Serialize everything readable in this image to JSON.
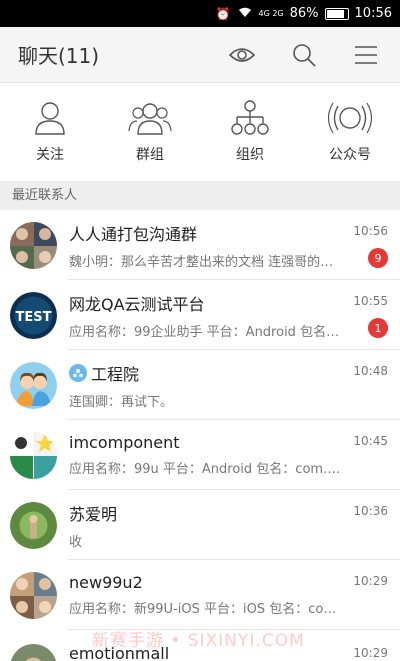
{
  "status_bar": {
    "battery": "86%",
    "time": "10:56",
    "network": "4G 2G"
  },
  "header": {
    "title": "聊天(11)"
  },
  "quick_actions": [
    {
      "label": "关注",
      "icon": "person-icon"
    },
    {
      "label": "群组",
      "icon": "group-icon"
    },
    {
      "label": "组织",
      "icon": "org-tree-icon"
    },
    {
      "label": "公众号",
      "icon": "broadcast-icon"
    }
  ],
  "section_title": "最近联系人",
  "conversations": [
    {
      "name": "人人通打包沟通群",
      "message": "魏小明：那么辛苦才整出来的文档  连强哥的…",
      "time": "10:56",
      "badge": "9"
    },
    {
      "name": "网龙QA云测试平台",
      "message": "应用名称：99企业助手 平台：Android 包名：…",
      "time": "10:55",
      "badge": "1",
      "avatar_text": "TEST"
    },
    {
      "name": "工程院",
      "message": "连国卿：再试下。",
      "time": "10:48"
    },
    {
      "name": "imcomponent",
      "message": "应用名称：99u 平台：Android 包名：com.nd.…",
      "time": "10:45"
    },
    {
      "name": "苏爱明",
      "message": "收",
      "time": "10:36"
    },
    {
      "name": "new99u2",
      "message": "应用名称：新99U-iOS 平台：iOS 包名：com.c…",
      "time": "10:29"
    },
    {
      "name": "emotionmall",
      "message": "",
      "time": "10:29"
    }
  ],
  "watermark": "新赛手游 • SIXINYI.COM",
  "colors": {
    "badge": "#e53935",
    "header_bg": "#f5f5f5"
  }
}
